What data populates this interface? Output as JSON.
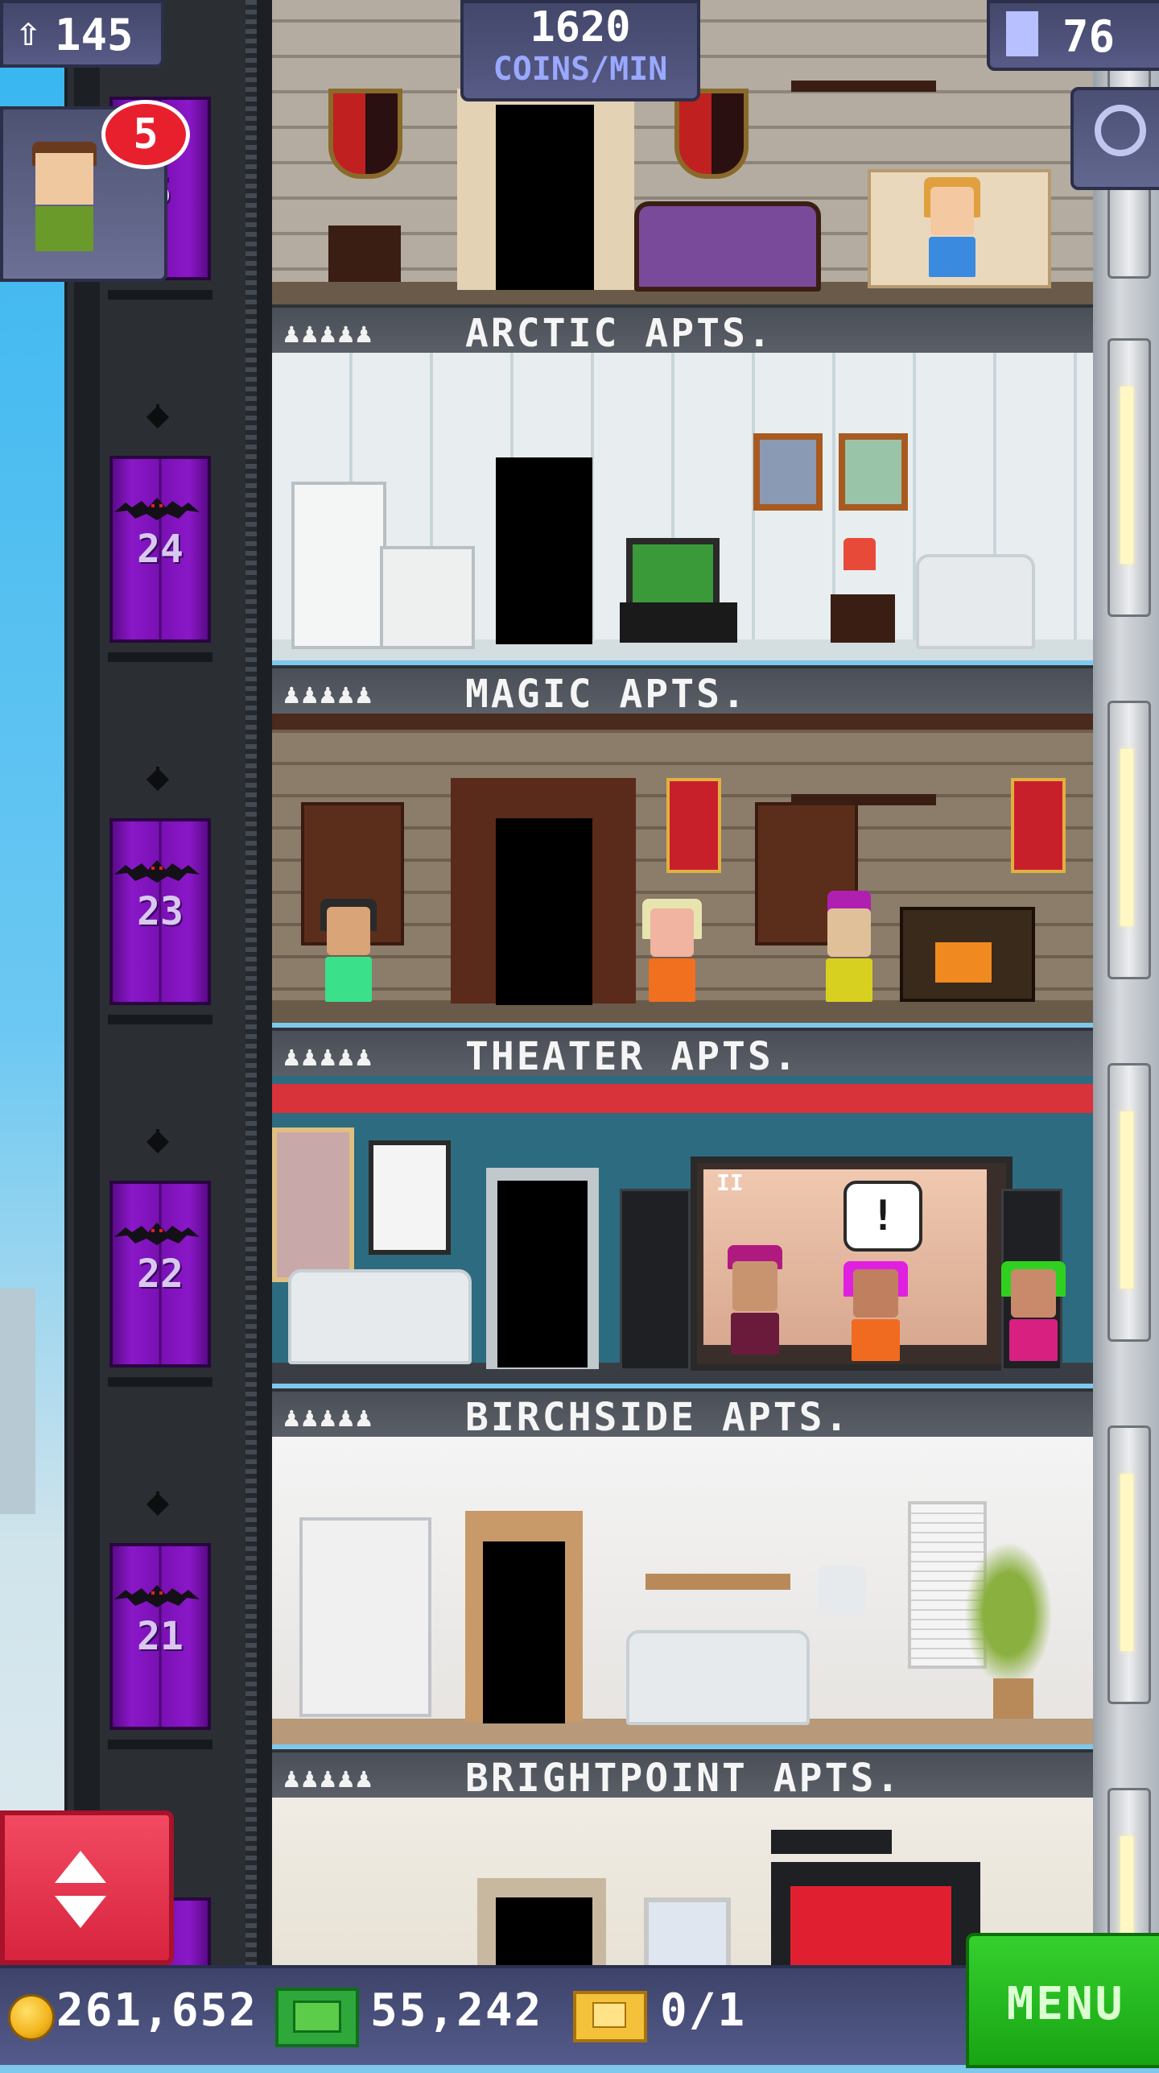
{
  "hud": {
    "population": "145",
    "coins_rate_value": "1620",
    "coins_rate_unit": "COINS/MIN",
    "floors_count": "76",
    "notification_count": "5"
  },
  "elevator": {
    "top_floor_number": "5",
    "floor_numbers": [
      "24",
      "23",
      "22",
      "21"
    ]
  },
  "floors": [
    {
      "name": "ARCTIC APTS.",
      "residents_icons": "♟♟♟♟♟"
    },
    {
      "name": "MAGIC APTS.",
      "residents_icons": "♟♟♟♟♟"
    },
    {
      "name": "THEATER APTS.",
      "residents_icons": "♟♟♟♟♟"
    },
    {
      "name": "BIRCHSIDE APTS.",
      "residents_icons": "♟♟♟♟♟"
    },
    {
      "name": "BRIGHTPOINT APTS.",
      "residents_icons": "♟♟♟♟♟"
    }
  ],
  "theater_screen": {
    "pause_icon": "II",
    "speech_mark": "!"
  },
  "bottom": {
    "coins": "261,652",
    "bux": "55,242",
    "tickets": "0/1",
    "menu_label": "MENU"
  },
  "colors": {
    "elevator_door": "#7a10b4",
    "menu_green": "#18a414",
    "updown_red": "#d8243e",
    "notif_red": "#e8202e"
  }
}
